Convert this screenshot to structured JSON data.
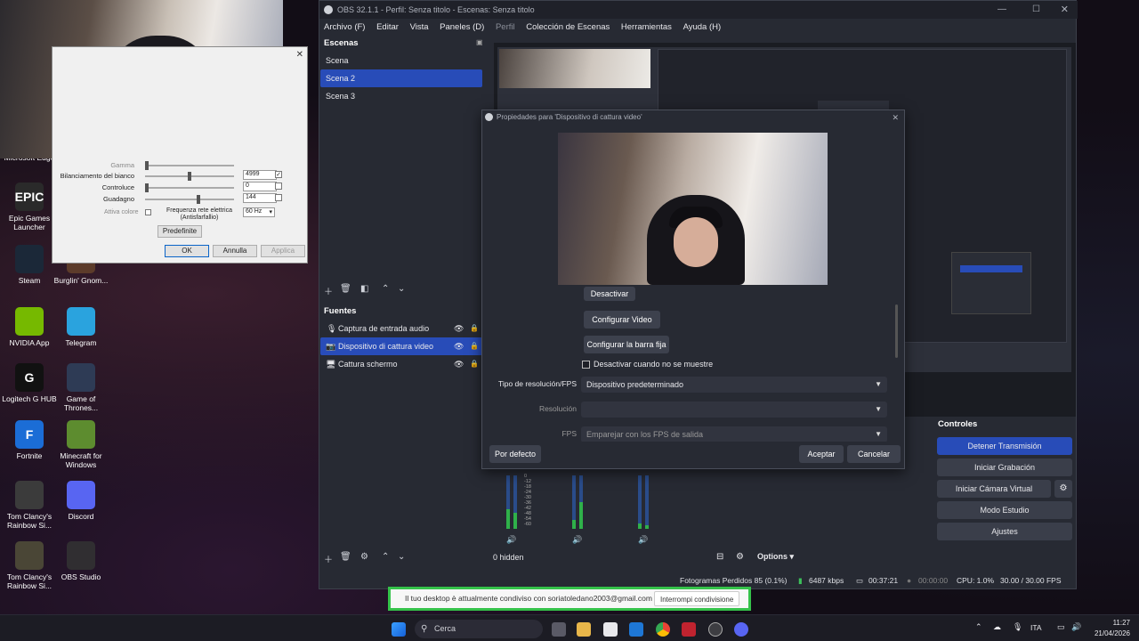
{
  "desktop": {
    "icons": [
      {
        "label": "Microsoft Edge",
        "glyph": "",
        "color": "#0f6fc6"
      },
      {
        "label": "Epic Games Launcher",
        "glyph": "EPIC",
        "color": "#2a2a2a"
      },
      {
        "label": "Steam",
        "glyph": "",
        "color": "#1b2838"
      },
      {
        "label": "Burglin' Gnom...",
        "glyph": "",
        "color": "#5c3b2a"
      },
      {
        "label": "NVIDIA App",
        "glyph": "",
        "color": "#76b900"
      },
      {
        "label": "Telegram",
        "glyph": "",
        "color": "#2aa3de"
      },
      {
        "label": "Logitech G HUB",
        "glyph": "G",
        "color": "#111111"
      },
      {
        "label": "Game of Thrones...",
        "glyph": "",
        "color": "#2e3b55"
      },
      {
        "label": "Fortnite",
        "glyph": "F",
        "color": "#1b6dd6"
      },
      {
        "label": "Minecraft for Windows",
        "glyph": "",
        "color": "#5d8c2f"
      },
      {
        "label": "Tom Clancy's Rainbow Si...",
        "glyph": "",
        "color": "#3b3b3b"
      },
      {
        "label": "Discord",
        "glyph": "",
        "color": "#5865f2"
      },
      {
        "label": "Tom Clancy's Rainbow Si...",
        "glyph": "",
        "color": "#4a4636"
      },
      {
        "label": "OBS Studio",
        "glyph": "",
        "color": "#302e31"
      }
    ]
  },
  "camera_dialog": {
    "rows": [
      {
        "label": "Gamma",
        "value": ""
      },
      {
        "label": "Bilanciamento del bianco",
        "value": "4999"
      },
      {
        "label": "Controluce",
        "value": "0"
      },
      {
        "label": "Guadagno",
        "value": "144"
      }
    ],
    "auto_color_label": "Attiva colore",
    "freq_label": "Frequenza rete elettrica (Antisfarfallio)",
    "freq_value": "60 Hz",
    "default_button": "Predefinite",
    "ok_button": "OK",
    "cancel_button": "Annulla",
    "apply_button": "Applica",
    "close_glyph": "✕"
  },
  "obs": {
    "title": "OBS 32.1.1 - Perfil: Senza titolo - Escenas: Senza titolo",
    "menu": [
      "Archivo (F)",
      "Editar",
      "Vista",
      "Paneles (D)",
      "Perfil",
      "Colección de Escenas",
      "Herramientas",
      "Ayuda (H)"
    ],
    "scenes_title": "Escenas",
    "scenes": [
      "Scena",
      "Scena 2",
      "Scena 3"
    ],
    "sources_title": "Fuentes",
    "sources": [
      "Captura de entrada audio",
      "Dispositivo di cattura video",
      "Cattura schermo"
    ],
    "mixer_hidden": "0 hidden",
    "mixer_options": "Options",
    "meter_scale": [
      "0",
      "-12",
      "-18",
      "-24",
      "-30",
      "-36",
      "-42",
      "-48",
      "-54",
      "-60"
    ],
    "controls_title": "Controles",
    "controls": [
      "Detener Transmisión",
      "Iniciar Grabación",
      "Iniciar Cámara Virtual",
      "Modo Estudio",
      "Ajustes"
    ],
    "status": {
      "dropped": "Fotogramas Perdidos 85 (0.1%)",
      "bitrate": "6487 kbps",
      "stream_time": "00:37:21",
      "rec_time": "00:00:00",
      "cpu": "CPU: 1.0%",
      "fps": "30.00 / 30.00 FPS"
    },
    "accent": "#284cb8"
  },
  "properties": {
    "title": "Propiedades para 'Dispositivo di cattura video'",
    "deactivate_button": "Desactivar",
    "configure_video_button": "Configurar Video",
    "configure_crossbar_button": "Configurar la barra fija",
    "deactivate_hidden_label": "Desactivar cuando no se muestre",
    "resolution_type_label": "Tipo de resolución/FPS",
    "resolution_type_value": "Dispositivo predeterminado",
    "resolution_label": "Resolución",
    "resolution_value": "",
    "fps_label": "FPS",
    "fps_value": "Emparejar con los FPS de salida",
    "defaults_button": "Por defecto",
    "accept_button": "Aceptar",
    "cancel_button": "Cancelar"
  },
  "share_bar": {
    "text": "Il tuo desktop è attualmente condiviso con soriatoledano2003@gmail.com",
    "stop_button": "Interrompi condivisione"
  },
  "taskbar": {
    "search_placeholder": "Cerca",
    "lang": "ITA",
    "time": "11:27",
    "date": "21/04/2026"
  }
}
